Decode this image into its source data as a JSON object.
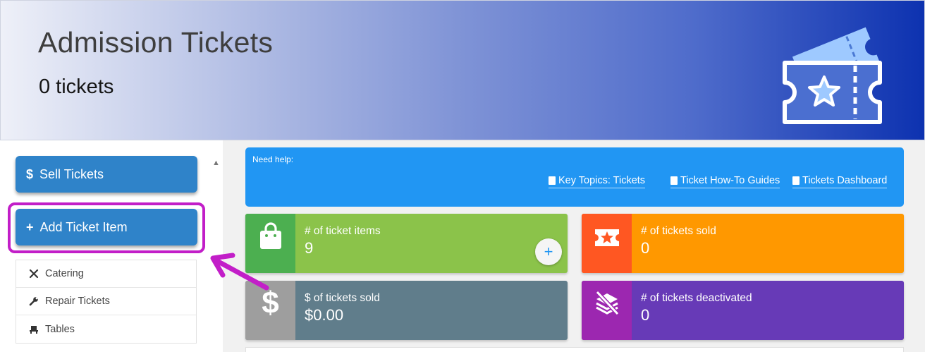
{
  "header": {
    "title": "Admission Tickets",
    "count": "0 tickets"
  },
  "sidebar": {
    "sell_button": {
      "symbol": "$",
      "label": "Sell Tickets"
    },
    "add_button": {
      "symbol": "+",
      "label": "Add Ticket Item"
    },
    "menu": [
      {
        "icon": "utensils-icon",
        "label": "Catering"
      },
      {
        "icon": "wrench-icon",
        "label": "Repair Tickets"
      },
      {
        "icon": "chair-icon",
        "label": "Tables"
      }
    ]
  },
  "help": {
    "label": "Need help:",
    "links": [
      "Key Topics: Tickets",
      "Ticket How-To Guides",
      "Tickets Dashboard"
    ]
  },
  "stats": [
    {
      "label": "# of ticket items",
      "value": "9",
      "icon": "shopping-bag-icon"
    },
    {
      "label": "# of tickets sold",
      "value": "0",
      "icon": "ticket-star-icon"
    },
    {
      "label": "$ of tickets sold",
      "value": "$0.00",
      "icon": "dollar-icon",
      "icon_text": "$"
    },
    {
      "label": "# of tickets deactivated",
      "value": "0",
      "icon": "layers-off-icon"
    }
  ],
  "colors": {
    "help_bg": "#2196f3",
    "button": "#2f83c9",
    "highlight": "#c21ec8",
    "card_items": "#8bc34a",
    "card_sold": "#ff9800",
    "card_revenue": "#607d8b",
    "card_deactivated": "#673ab7"
  }
}
